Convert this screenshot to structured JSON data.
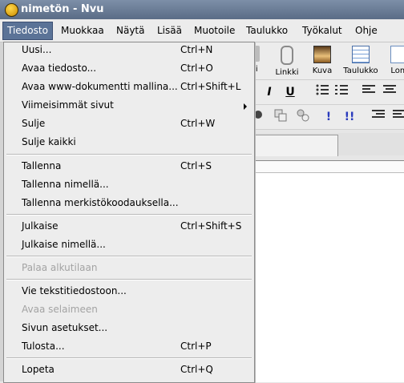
{
  "window": {
    "title": "nimetön - Nvu"
  },
  "menubar": {
    "items": [
      {
        "label": "Tiedosto",
        "active": true
      },
      {
        "label": "Muokkaa"
      },
      {
        "label": "Näytä"
      },
      {
        "label": "Lisää"
      },
      {
        "label": "Muotoile"
      },
      {
        "label": "Taulukko"
      },
      {
        "label": "Työkalut"
      },
      {
        "label": "Ohje"
      }
    ]
  },
  "toolbar": {
    "buttons": [
      {
        "label": "uri"
      },
      {
        "label": "Linkki",
        "icon": "link-icon"
      },
      {
        "label": "Kuva",
        "icon": "image-icon"
      },
      {
        "label": "Taulukko",
        "icon": "table-icon"
      },
      {
        "label": "Lom",
        "icon": "form-icon"
      }
    ]
  },
  "format_toolbar": {
    "buttons": [
      {
        "label": "I",
        "icon": "italic-icon"
      },
      {
        "label": "U",
        "icon": "underline-icon"
      }
    ]
  },
  "file_menu": {
    "items": [
      {
        "label": "Uusi...",
        "accel": "Ctrl+N"
      },
      {
        "label": "Avaa tiedosto...",
        "accel": "Ctrl+O"
      },
      {
        "label": "Avaa www-dokumentti mallina...",
        "accel": "Ctrl+Shift+L"
      },
      {
        "label": "Viimeisimmät sivut",
        "submenu": true
      },
      {
        "label": "Sulje",
        "accel": "Ctrl+W"
      },
      {
        "label": "Sulje kaikki"
      },
      {
        "label": "Tallenna",
        "accel": "Ctrl+S"
      },
      {
        "label": "Tallenna nimellä..."
      },
      {
        "label": "Tallenna merkistökoodauksella..."
      },
      {
        "label": "Julkaise",
        "accel": "Ctrl+Shift+S"
      },
      {
        "label": "Julkaise nimellä..."
      },
      {
        "label": "Palaa alkutilaan",
        "disabled": true
      },
      {
        "label": "Vie tekstitiedostoon..."
      },
      {
        "label": "Avaa selaimeen",
        "disabled": true
      },
      {
        "label": "Sivun asetukset..."
      },
      {
        "label": "Tulosta...",
        "accel": "Ctrl+P"
      },
      {
        "label": "Lopeta",
        "accel": "Ctrl+Q"
      }
    ]
  },
  "colors": {
    "menu_highlight": "#5b7397",
    "titlebar": "#6a7c96",
    "disabled_text": "#a3a3a3"
  }
}
